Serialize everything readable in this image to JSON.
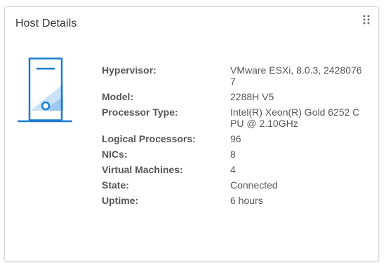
{
  "card": {
    "title": "Host Details",
    "icons": {
      "drag": "drag-handle-icon",
      "host": "server-icon"
    },
    "accent_color": "#1a7bd4"
  },
  "properties": [
    {
      "label": "Hypervisor:",
      "value": "VMware ESXi, 8.0.3, 24280767"
    },
    {
      "label": "Model:",
      "value": "2288H V5"
    },
    {
      "label": "Processor Type:",
      "value": "Intel(R) Xeon(R) Gold 6252 CPU @ 2.10GHz"
    },
    {
      "label": "Logical Processors:",
      "value": "96"
    },
    {
      "label": "NICs:",
      "value": "8"
    },
    {
      "label": "Virtual Machines:",
      "value": "4"
    },
    {
      "label": "State:",
      "value": "Connected"
    },
    {
      "label": "Uptime:",
      "value": "6 hours"
    }
  ]
}
